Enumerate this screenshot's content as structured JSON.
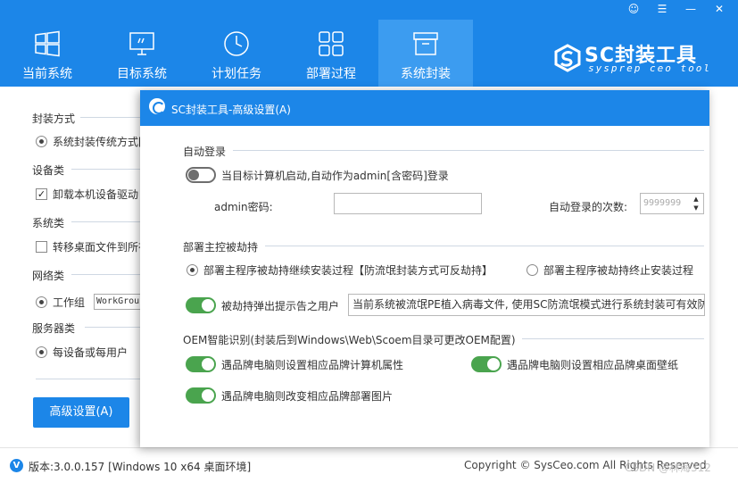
{
  "window_controls": [
    "user-icon",
    "menu-icon",
    "minimize-icon",
    "close-icon"
  ],
  "nav": {
    "items": [
      {
        "label": "当前系统",
        "icon": "windows-icon"
      },
      {
        "label": "目标系统",
        "icon": "monitor-icon"
      },
      {
        "label": "计划任务",
        "icon": "clock-icon"
      },
      {
        "label": "部署过程",
        "icon": "grid-icon"
      },
      {
        "label": "系统封装",
        "icon": "package-icon",
        "active": true
      }
    ]
  },
  "logo": {
    "title": "SC封装工具",
    "subtitle": "sysprep ceo tool"
  },
  "background": {
    "sections": [
      {
        "label": "封装方式",
        "option": "系统封装传统方式[",
        "control": "radio",
        "checked": true
      },
      {
        "label": "设备类",
        "option": "卸载本机设备驱动",
        "control": "checkbox",
        "checked": true
      },
      {
        "label": "系统类",
        "option": "转移桌面文件到所有",
        "control": "checkbox",
        "checked": false
      },
      {
        "label": "网络类",
        "option": "工作组",
        "control": "radio",
        "checked": true,
        "input_value": "WorkGroup"
      },
      {
        "label": "服务器类",
        "option": "每设备或每用户",
        "control": "radio",
        "checked": true
      }
    ],
    "advanced_button": "高级设置(A)"
  },
  "dialog": {
    "title": "SC封装工具-高级设置(A)",
    "auto_login": {
      "section": "自动登录",
      "toggle_label": "当目标计算机启动,自动作为admin[含密码]登录",
      "toggle_on": false,
      "password_label": "admin密码:",
      "password_value": "",
      "count_label": "自动登录的次数:",
      "count_placeholder": "9999999"
    },
    "hijack": {
      "section": "部署主控被劫持",
      "option_continue": "部署主程序被劫持继续安装过程【防流氓封装方式可反劫持】",
      "option_terminate": "部署主程序被劫持终止安装过程",
      "selected": "continue",
      "popup_label": "被劫持弹出提示告之用户",
      "popup_on": true,
      "popup_message": "当前系统被流氓PE植入病毒文件, 使用SC防流氓模式进行系统封装可有效防"
    },
    "oem": {
      "section": "OEM智能识别(封装后到Windows\\Web\\Scoem目录可更改OEM配置)",
      "toggles": [
        {
          "label": "遇品牌电脑则设置相应品牌计算机属性",
          "on": true
        },
        {
          "label": "遇品牌电脑则设置相应品牌桌面壁纸",
          "on": true
        },
        {
          "label": "遇品牌电脑则改变相应品牌部署图片",
          "on": true
        }
      ]
    }
  },
  "footer": {
    "version": "版本:3.0.0.157 [Windows 10 x64 桌面环境]",
    "copyright": "Copyright © SysCeo.com All Rights Reserved",
    "watermark": "CSDN @林海312"
  },
  "colors": {
    "brand_blue": "#1c86e8",
    "toggle_green": "#4aa44e"
  }
}
